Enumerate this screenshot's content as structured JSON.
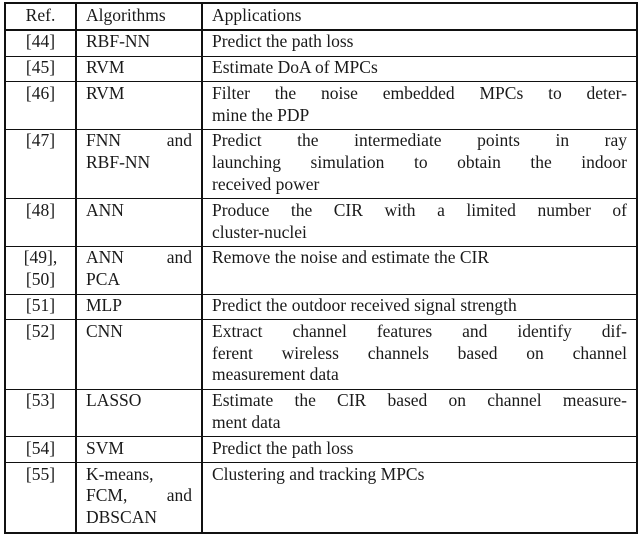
{
  "table": {
    "caption_present": false,
    "columns": [
      {
        "key": "ref",
        "label": "Ref."
      },
      {
        "key": "algorithms",
        "label": "Algorithms"
      },
      {
        "key": "applications",
        "label": "Applications"
      }
    ],
    "rows": [
      {
        "ref_lines": [
          "[44]"
        ],
        "alg_lines": [
          "RBF-NN"
        ],
        "app_lines": [
          "Predict the path loss"
        ],
        "app_justified": [
          false
        ],
        "filler_lines": 0
      },
      {
        "ref_lines": [
          "[45]"
        ],
        "alg_lines": [
          "RVM"
        ],
        "app_lines": [
          "Estimate DoA of MPCs"
        ],
        "app_justified": [
          false
        ],
        "filler_lines": 0
      },
      {
        "ref_lines": [
          "[46]"
        ],
        "alg_lines": [
          "RVM"
        ],
        "app_lines": [
          "Filter the noise embedded MPCs to deter-",
          "mine the PDP"
        ],
        "app_justified": [
          true,
          false
        ],
        "filler_lines": 0
      },
      {
        "ref_lines": [
          "[47]"
        ],
        "alg_lines": [
          "FNN and",
          "RBF-NN"
        ],
        "app_lines": [
          "Predict the intermediate points in ray",
          "launching simulation to obtain the indoor",
          "received power"
        ],
        "app_justified": [
          true,
          true,
          false
        ],
        "filler_lines": 0
      },
      {
        "ref_lines": [
          "[48]"
        ],
        "alg_lines": [
          "ANN"
        ],
        "app_lines": [
          "Produce the CIR with a limited number of",
          "cluster-nuclei"
        ],
        "app_justified": [
          true,
          false
        ],
        "filler_lines": 0
      },
      {
        "ref_lines": [
          "[49],",
          "[50]"
        ],
        "alg_lines": [
          "ANN and",
          "PCA"
        ],
        "app_lines": [
          "Remove the noise and estimate the CIR"
        ],
        "app_justified": [
          false
        ],
        "filler_lines": 0
      },
      {
        "ref_lines": [
          "[51]"
        ],
        "alg_lines": [
          "MLP"
        ],
        "app_lines": [
          "Predict the outdoor received signal strength"
        ],
        "app_justified": [
          false
        ],
        "filler_lines": 0
      },
      {
        "ref_lines": [
          "[52]"
        ],
        "alg_lines": [
          "CNN"
        ],
        "app_lines": [
          "Extract channel features and identify dif-",
          "ferent wireless channels based on channel",
          "measurement data"
        ],
        "app_justified": [
          true,
          true,
          false
        ],
        "filler_lines": 0
      },
      {
        "ref_lines": [
          "[53]"
        ],
        "alg_lines": [
          "LASSO"
        ],
        "app_lines": [
          "Estimate the CIR based on channel measure-",
          "ment data"
        ],
        "app_justified": [
          true,
          false
        ],
        "filler_lines": 0
      },
      {
        "ref_lines": [
          "[54]"
        ],
        "alg_lines": [
          "SVM"
        ],
        "app_lines": [
          "Predict the path loss"
        ],
        "app_justified": [
          false
        ],
        "filler_lines": 0
      },
      {
        "ref_lines": [
          "[55]"
        ],
        "alg_lines": [
          "K-means,",
          "FCM, and",
          "DBSCAN"
        ],
        "app_lines": [
          "Clustering and tracking MPCs"
        ],
        "app_justified": [
          false
        ],
        "filler_lines": 0
      }
    ]
  },
  "style": {
    "text_color": "#1a1a1a",
    "background": "#ffffff",
    "border_color": "#111111"
  }
}
